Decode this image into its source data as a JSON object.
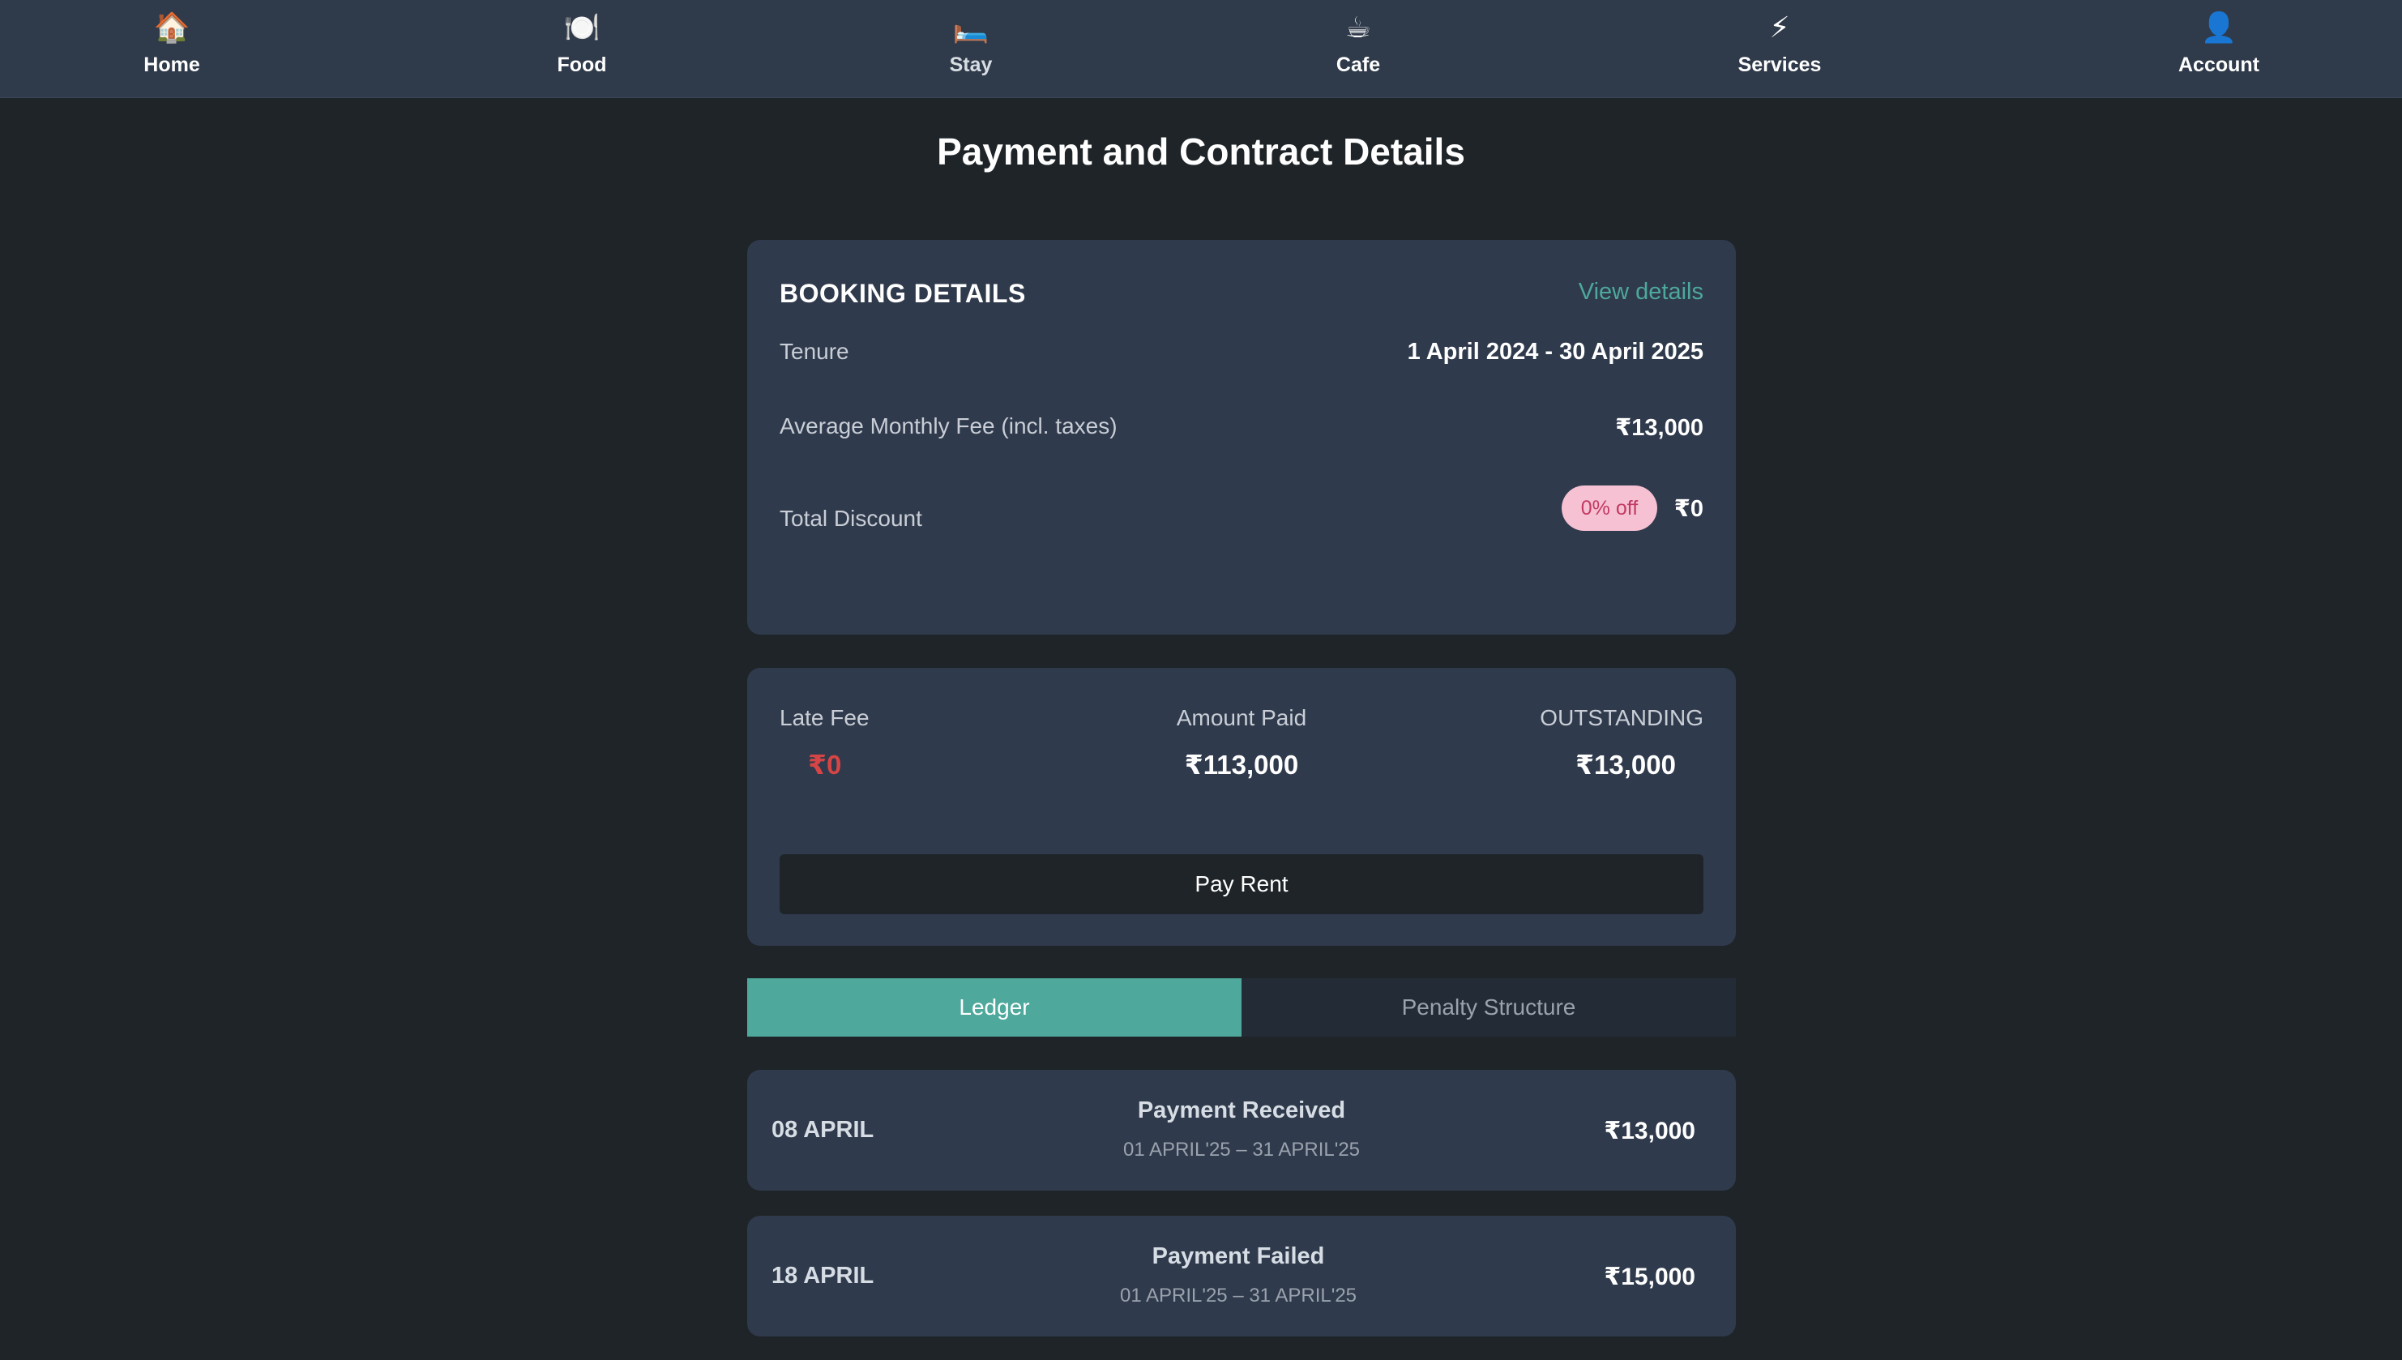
{
  "nav": {
    "items": [
      {
        "label": "Home",
        "icon": "🏠"
      },
      {
        "label": "Food",
        "icon": "🍽️"
      },
      {
        "label": "Stay",
        "icon": "🛏️"
      },
      {
        "label": "Cafe",
        "icon": "☕"
      },
      {
        "label": "Services",
        "icon": "⚡"
      },
      {
        "label": "Account",
        "icon": "👤"
      }
    ]
  },
  "page": {
    "title": "Payment and Contract Details"
  },
  "booking": {
    "title": "BOOKING DETAILS",
    "view_details": "View details",
    "tenure_label": "Tenure",
    "tenure_value": "1 April 2024 - 30 April 2025",
    "fee_label": "Average Monthly Fee (incl. taxes)",
    "fee_value": "₹13,000",
    "discount_label": "Total Discount",
    "discount_badge": "0% off",
    "discount_value": "₹0"
  },
  "summary": {
    "late_fee_label": "Late Fee",
    "late_fee_value": "₹0",
    "paid_label": "Amount Paid",
    "paid_value": "₹113,000",
    "outstanding_label": "OUTSTANDING",
    "outstanding_value": "₹13,000",
    "pay_button": "Pay Rent"
  },
  "tabs": {
    "ledger": "Ledger",
    "penalty": "Penalty Structure"
  },
  "ledger": [
    {
      "date": "08 APRIL",
      "status": "Payment Received",
      "period": "01 APRIL'25 – 31 APRIL'25",
      "amount": "₹13,000"
    },
    {
      "date": "18 APRIL",
      "status": "Payment Failed",
      "period": "01 APRIL'25 – 31 APRIL'25",
      "amount": "₹15,000"
    }
  ],
  "colors": {
    "accent": "#4ea89b",
    "card": "#2f3a4c",
    "background": "#1e2427",
    "late_fee": "#d64545",
    "badge_bg": "#f6c1d3"
  }
}
